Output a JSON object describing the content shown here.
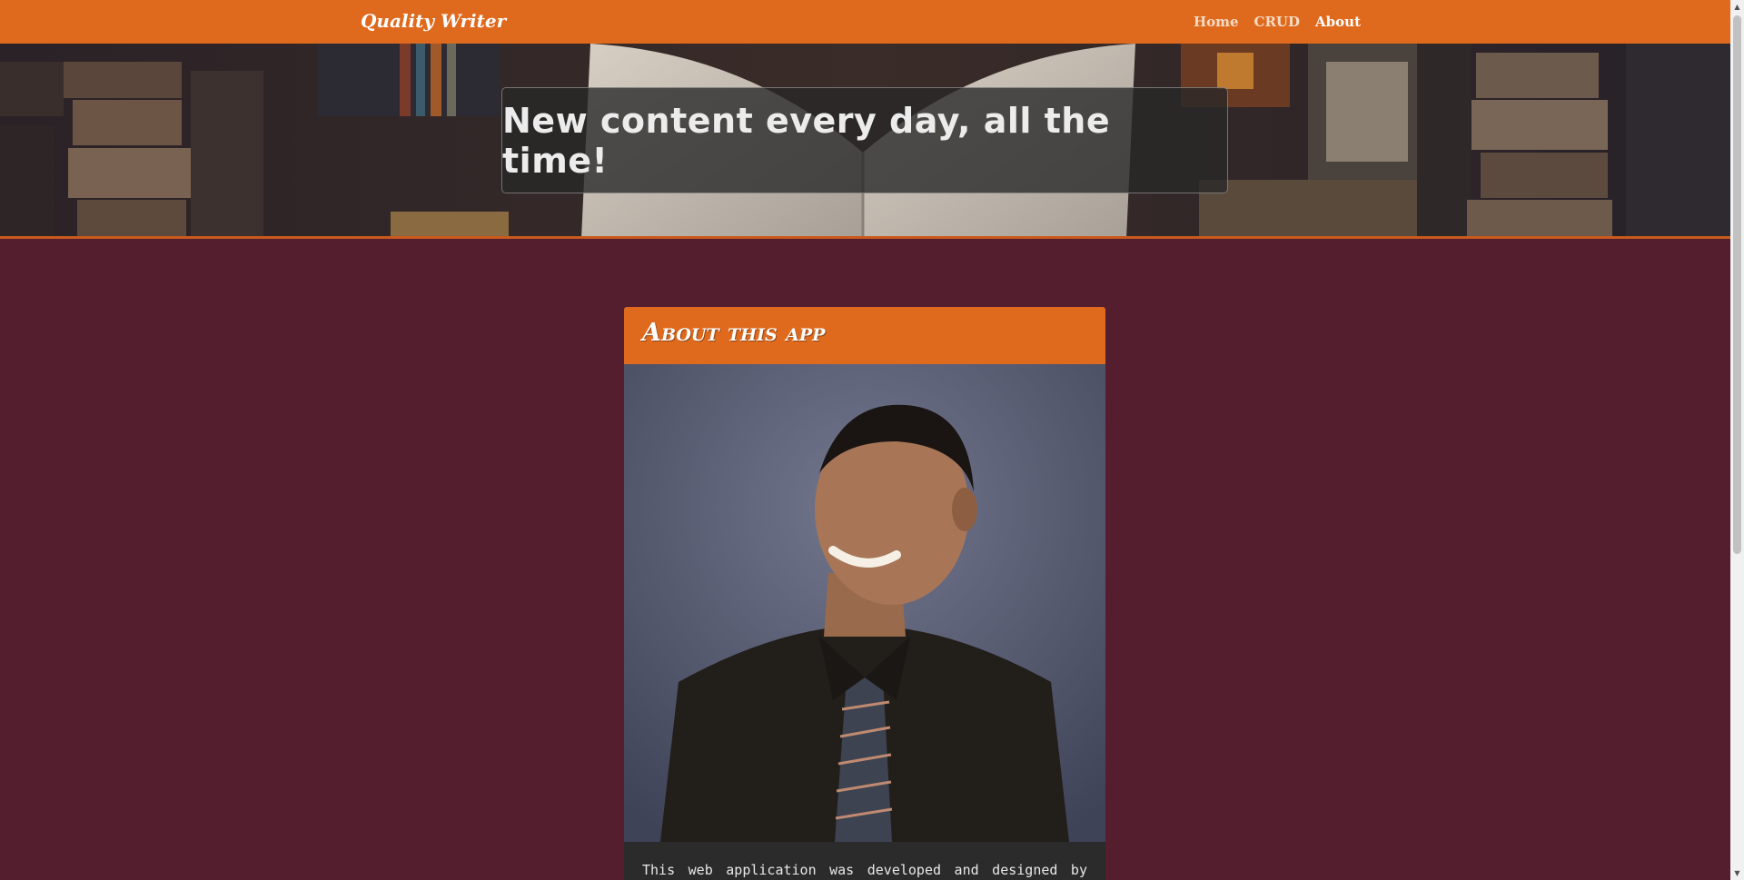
{
  "navbar": {
    "brand": "Quality Writer",
    "links": [
      {
        "label": "Home",
        "active": false
      },
      {
        "label": "CRUD",
        "active": false
      },
      {
        "label": "About",
        "active": true
      }
    ]
  },
  "hero": {
    "headline": "New content every day, all the time!"
  },
  "about": {
    "title": "About this app",
    "body": "This web application was developed and designed by"
  },
  "colors": {
    "navbar": "#df6a1e",
    "page_background": "#541e2f",
    "card_body": "#2b2b2b"
  },
  "icons": {
    "scroll_up": "triangle-up-icon",
    "scroll_down": "triangle-down-icon"
  }
}
